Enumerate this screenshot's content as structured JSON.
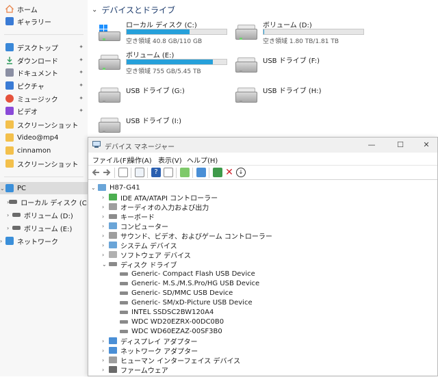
{
  "sidebar": {
    "quick": [
      {
        "label": "ホーム",
        "icon": "home-icon",
        "color": "#e8834a"
      },
      {
        "label": "ギャラリー",
        "icon": "gallery-icon",
        "color": "#3a7bd5"
      }
    ],
    "pinned": [
      {
        "label": "デスクトップ",
        "icon": "desktop-icon",
        "color": "#3a88d8"
      },
      {
        "label": "ダウンロード",
        "icon": "download-icon",
        "color": "#2f9a5d"
      },
      {
        "label": "ドキュメント",
        "icon": "documents-icon",
        "color": "#8b8fa3"
      },
      {
        "label": "ピクチャ",
        "icon": "pictures-icon",
        "color": "#3a7bd5"
      },
      {
        "label": "ミュージック",
        "icon": "music-icon",
        "color": "#e5523c"
      },
      {
        "label": "ビデオ",
        "icon": "videos-icon",
        "color": "#8a4ad8"
      },
      {
        "label": "スクリーンショット",
        "icon": "folder-icon",
        "color": "#f3c04c"
      },
      {
        "label": "Video@mp4",
        "icon": "folder-icon",
        "color": "#f3c04c"
      },
      {
        "label": "cinnamon",
        "icon": "folder-icon",
        "color": "#f3c04c"
      },
      {
        "label": "スクリーンショット",
        "icon": "folder-icon",
        "color": "#f3c04c"
      }
    ],
    "pin_glyph": "📌",
    "this_pc": {
      "label": "PC",
      "icon": "pc-icon"
    },
    "drives": [
      {
        "label": "ローカル ディスク (C:)",
        "icon": "drive-icon"
      },
      {
        "label": "ボリューム (D:)",
        "icon": "drive-icon"
      },
      {
        "label": "ボリューム (E:)",
        "icon": "drive-icon"
      }
    ],
    "network": {
      "label": "ネットワーク",
      "icon": "network-icon"
    }
  },
  "main": {
    "section_title": "デバイスとドライブ",
    "drives": [
      {
        "name": "ローカル ディスク (C:)",
        "free": "空き領域 40.8 GB/110 GB",
        "used_fraction": 0.63,
        "bar": true,
        "os": true
      },
      {
        "name": "ボリューム (D:)",
        "free": "空き領域 1.80 TB/1.81 TB",
        "used_fraction": 0.01,
        "bar": true
      },
      {
        "name": "ボリューム (E:)",
        "free": "空き領域 755 GB/5.45 TB",
        "used_fraction": 0.86,
        "bar": true
      },
      {
        "name": "USB ドライブ (F:)",
        "bar": false
      },
      {
        "name": "USB ドライブ (G:)",
        "bar": false
      },
      {
        "name": "USB ドライブ (H:)",
        "bar": false
      },
      {
        "name": "USB ドライブ (I:)",
        "bar": false
      }
    ]
  },
  "devmgr": {
    "title": "デバイス マネージャー",
    "window_buttons": {
      "minimize": "—",
      "maximize": "☐",
      "close": "✕"
    },
    "menu": [
      "ファイル(F)",
      "操作(A)",
      "表示(V)",
      "ヘルプ(H)"
    ],
    "toolbar": [
      "back-icon",
      "forward-icon",
      "show-hide-icon",
      "properties-icon",
      "help-icon",
      "details-icon",
      "scan-icon",
      "monitor-icon",
      "update-driver-icon",
      "uninstall-icon",
      "disable-icon"
    ],
    "tree": {
      "root": "H87-G41",
      "categories": [
        {
          "label": "IDE ATA/ATAPI コントローラー",
          "icon": "ide-icon",
          "expanded": false
        },
        {
          "label": "オーディオの入力および出力",
          "icon": "audio-icon",
          "expanded": false
        },
        {
          "label": "キーボード",
          "icon": "keyboard-icon",
          "expanded": false
        },
        {
          "label": "コンピューター",
          "icon": "computer-icon",
          "expanded": false
        },
        {
          "label": "サウンド、ビデオ、およびゲーム コントローラー",
          "icon": "sound-icon",
          "expanded": false
        },
        {
          "label": "システム デバイス",
          "icon": "system-icon",
          "expanded": false
        },
        {
          "label": "ソフトウェア デバイス",
          "icon": "software-icon",
          "expanded": false
        },
        {
          "label": "ディスク ドライブ",
          "icon": "disk-drive-icon",
          "expanded": true,
          "children": [
            "Generic- Compact Flash USB Device",
            "Generic- M.S./M.S.Pro/HG USB Device",
            "Generic- SD/MMC USB Device",
            "Generic- SM/xD-Picture USB Device",
            "INTEL SSDSC2BW120A4",
            "WDC WD20EZRX-00DC0B0",
            "WDC WD60EZAZ-00SF3B0"
          ]
        },
        {
          "label": "ディスプレイ アダプター",
          "icon": "display-icon",
          "expanded": false
        },
        {
          "label": "ネットワーク アダプター",
          "icon": "network-adapter-icon",
          "expanded": false
        },
        {
          "label": "ヒューマン インターフェイス デバイス",
          "icon": "hid-icon",
          "expanded": false
        },
        {
          "label": "ファームウェア",
          "icon": "firmware-icon",
          "expanded": false
        }
      ]
    }
  }
}
